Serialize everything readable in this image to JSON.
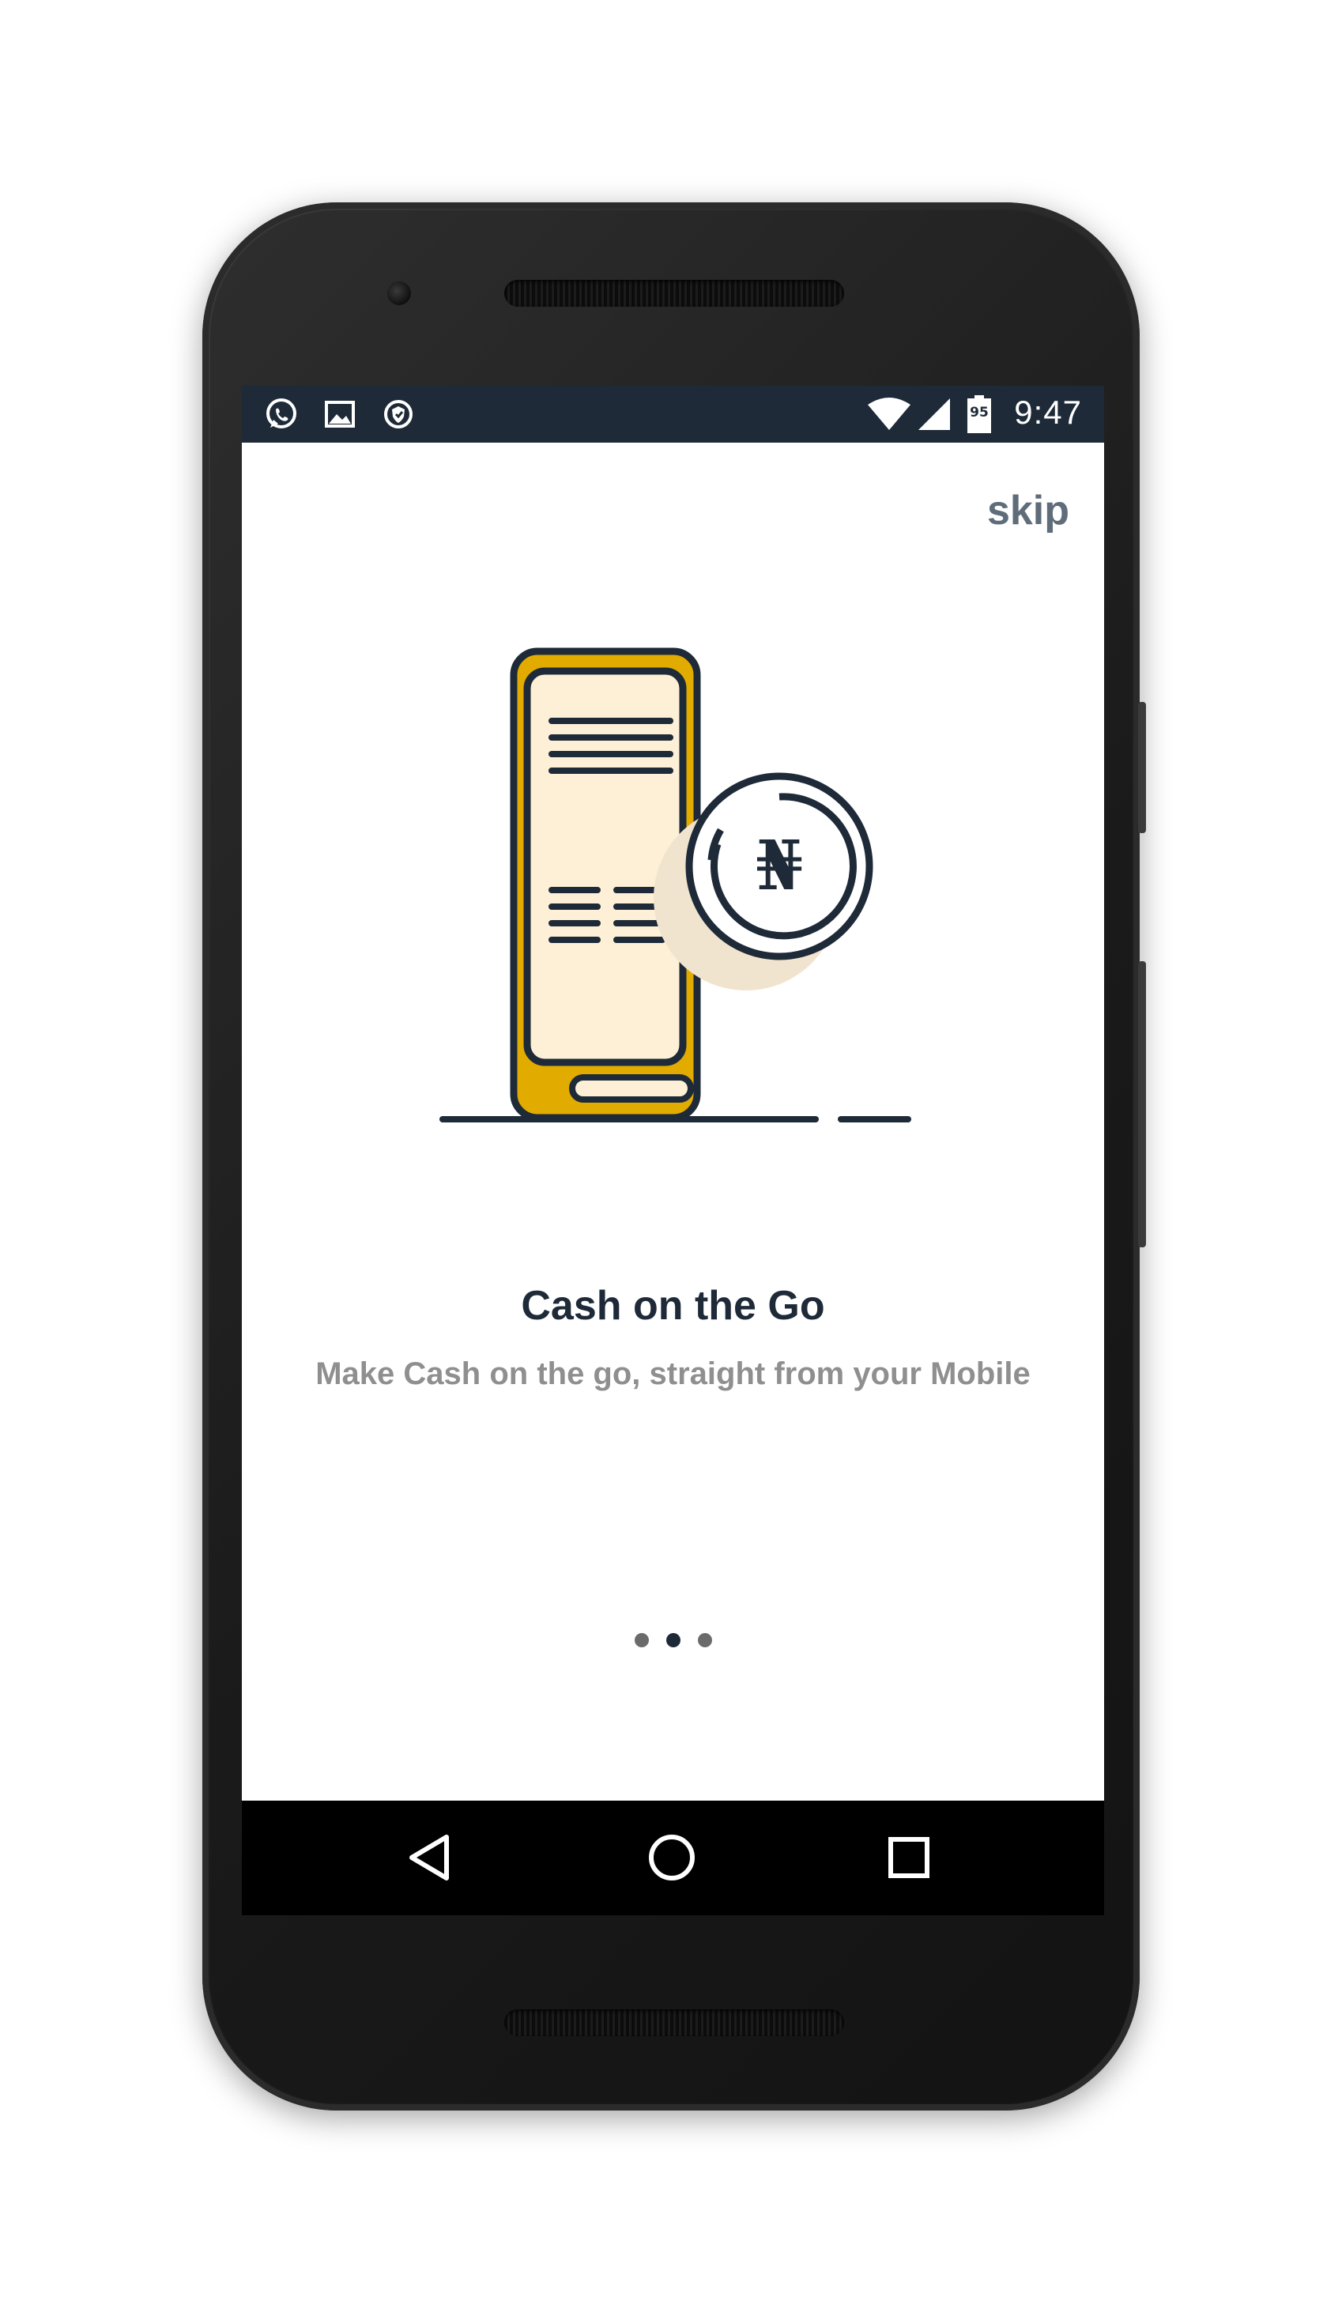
{
  "status_bar": {
    "time": "9:47",
    "battery_level": "95",
    "left_icons": [
      "whatsapp-icon",
      "gallery-icon",
      "shield-icon"
    ],
    "right_icons": [
      "wifi-icon",
      "signal-icon",
      "battery-icon"
    ]
  },
  "header": {
    "skip_label": "skip"
  },
  "illustration": {
    "currency_symbol": "₦",
    "colors": {
      "phone_body": "#e2ab00",
      "phone_screen": "#fdf0d6",
      "outline": "#1e2a38",
      "coin_shadow": "#f1e4cf"
    }
  },
  "slide": {
    "title": "Cash on the Go",
    "subtitle": "Make Cash on the go, straight from your Mobile"
  },
  "pager": {
    "total": 3,
    "active_index": 1
  },
  "nav_bar": {
    "buttons": [
      "back-icon",
      "home-icon",
      "recents-icon"
    ]
  },
  "colors": {
    "status_bar": "#1e2a38",
    "title": "#1e2a38",
    "subtitle": "#8f8f8f",
    "skip": "#5f6d7a",
    "nav_bar": "#000000"
  }
}
